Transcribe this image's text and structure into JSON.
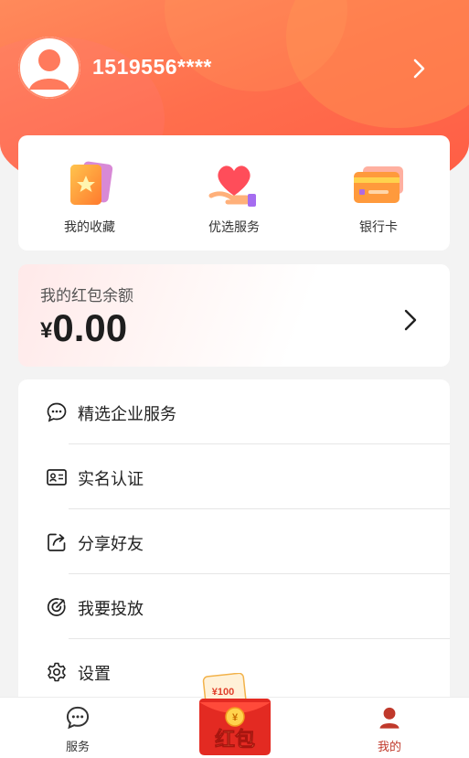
{
  "header": {
    "username": "1519556****"
  },
  "quick_actions": [
    {
      "icon": "favorites-cards-icon",
      "label": "我的收藏"
    },
    {
      "icon": "heart-hand-icon",
      "label": "优选服务"
    },
    {
      "icon": "bank-card-icon",
      "label": "银行卡"
    }
  ],
  "balance": {
    "title": "我的红包余额",
    "currency": "¥",
    "amount": "0.00"
  },
  "menu": [
    {
      "icon": "chat-bubble-icon",
      "label": "精选企业服务"
    },
    {
      "icon": "id-card-icon",
      "label": "实名认证"
    },
    {
      "icon": "share-icon",
      "label": "分享好友"
    },
    {
      "icon": "target-icon",
      "label": "我要投放"
    },
    {
      "icon": "gear-icon",
      "label": "设置"
    }
  ],
  "tabbar": {
    "items": [
      {
        "icon": "chat-bubble-icon",
        "label": "服务"
      },
      {
        "icon": "person-icon",
        "label": "我的"
      }
    ],
    "red_packet": {
      "badge": "¥100",
      "label": "红包",
      "coin": "¥"
    }
  },
  "colors": {
    "accent": "#ff6a4d",
    "active_tab": "#c0392b",
    "text": "#222222"
  }
}
